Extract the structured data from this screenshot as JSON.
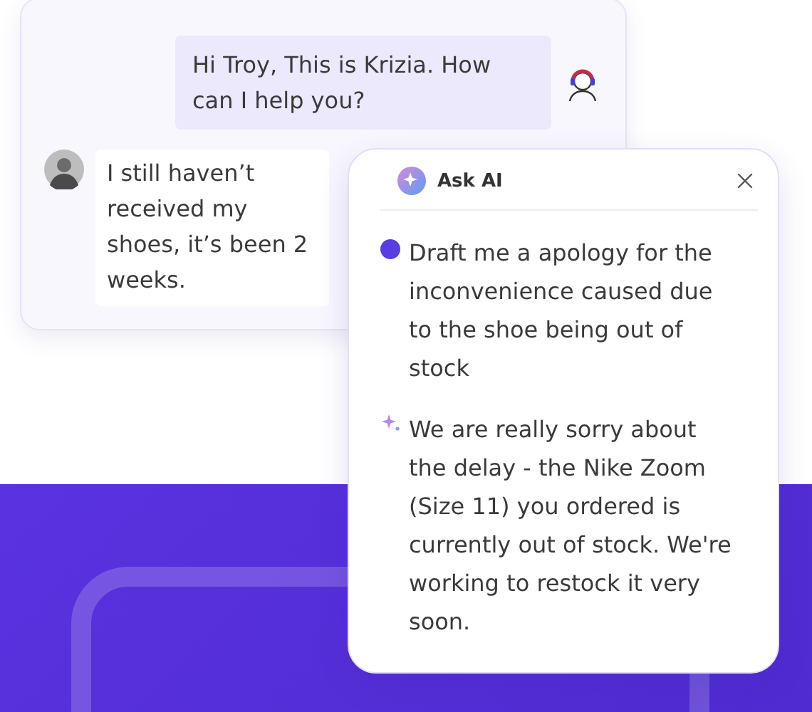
{
  "chat": {
    "messages": [
      {
        "kind": "agent",
        "text": "Hi Troy, This is Krizia. How can I help you?"
      },
      {
        "kind": "customer",
        "text": "I still haven’t received my shoes, it’s been 2 weeks."
      }
    ]
  },
  "assistant": {
    "title": "Ask AI",
    "prompt": "Draft me a apology for the inconvenience caused due to the shoe being out of stock",
    "response": "We are really sorry about the delay - the Nike Zoom (Size 11) you ordered is currently out of stock. We're working to restock it very soon."
  }
}
